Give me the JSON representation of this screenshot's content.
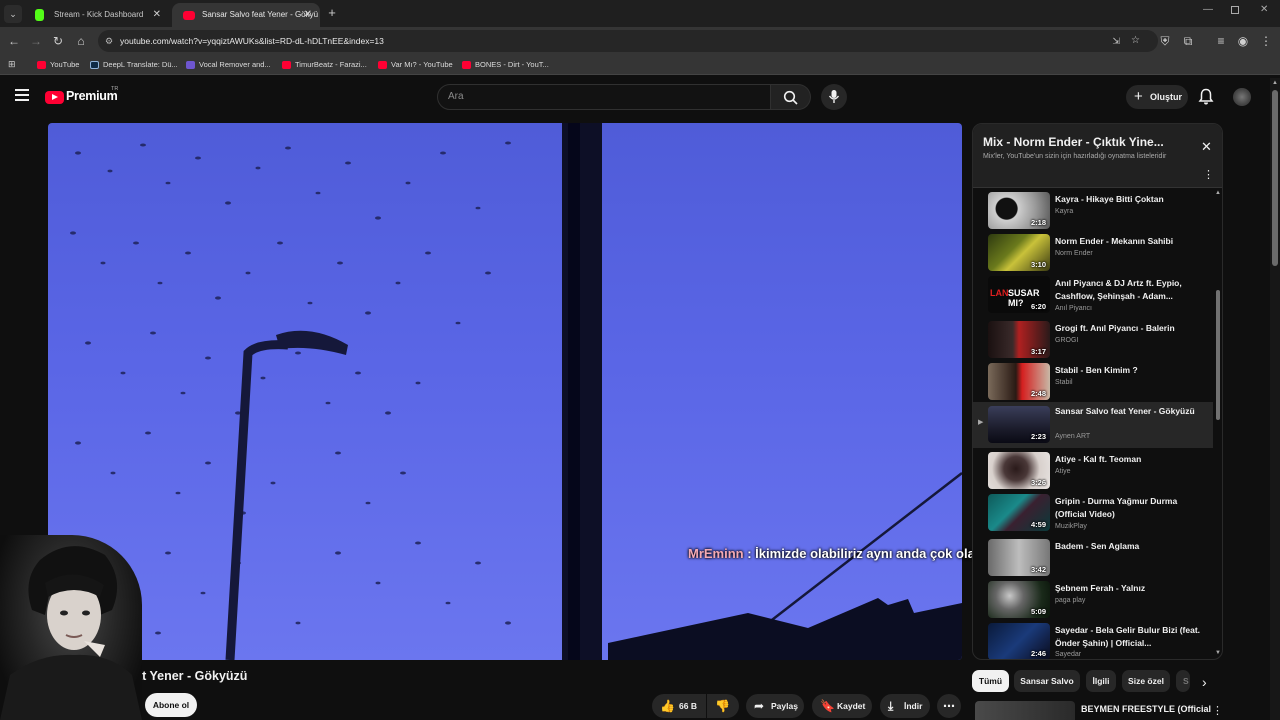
{
  "browser": {
    "tabs": [
      {
        "label": "Stream - Kick Dashboard",
        "close": "✕"
      },
      {
        "label": "Sansar Salvo feat Yener - Gökyü",
        "close": "✕"
      }
    ],
    "new_tab": "+",
    "url": "youtube.com/watch?v=yqqiztAWUKs&list=RD-dL-hDLTnEE&index=13",
    "bookmarks": [
      "YouTube",
      "DeepL Translate: Dü...",
      "Vocal Remover and...",
      "TimurBeatz - Farazi...",
      "Var Mı? - YouTube",
      "BONES - Dirt - YouT..."
    ],
    "colors": {
      "kick": "#53fc18",
      "youtube": "#ff0033",
      "deepl": "#0f2b46",
      "vocal": "#6e56cf"
    }
  },
  "header": {
    "logo_text": "Premium",
    "logo_region": "TR",
    "search_placeholder": "Ara",
    "create_label": "Oluştur"
  },
  "video": {
    "subtitle_user": "MrEminn",
    "subtitle_text": " : İkimizde olabiliriz aynı anda çok olası bu arada",
    "title": "feat Yener - Gökyüzü"
  },
  "actions": {
    "subscribe": "Abone ol",
    "likes": "66 B",
    "share": "Paylaş",
    "save": "Kaydet",
    "download": "İndir"
  },
  "playlist": {
    "title": "Mix - Norm Ender - Çıktık Yine...",
    "subtitle": "Mix'ler, YouTube'un sizin için hazırladığı oynatma listeleridir",
    "items": [
      {
        "title": "Kayra - Hikaye Bitti Çoktan",
        "channel": "Kayra",
        "duration": "2:18"
      },
      {
        "title": "Norm Ender - Mekanın Sahibi",
        "channel": "Norm Ender",
        "duration": "3:10"
      },
      {
        "title": "Anıl Piyancı & DJ Artz ft. Eypio, Cashflow, Şehinşah - Adam...",
        "channel": "Anıl Piyancı",
        "duration": "6:20"
      },
      {
        "title": "Grogi ft. Anıl Piyancı - Balerin",
        "channel": "GROGI",
        "duration": "3:17"
      },
      {
        "title": "Stabil - Ben Kimim ?",
        "channel": "Stabil",
        "duration": "2:48"
      },
      {
        "title": "Sansar Salvo feat Yener - Gökyüzü",
        "channel": "Aynen ART",
        "duration": "2:23",
        "current": true
      },
      {
        "title": "Atiye - Kal ft. Teoman",
        "channel": "Atiye",
        "duration": "3:26"
      },
      {
        "title": "Gripin - Durma Yağmur Durma (Official Video)",
        "channel": "MuzikPlay",
        "duration": "4:59"
      },
      {
        "title": "Badem - Sen Aglama",
        "channel": "",
        "duration": "3:42"
      },
      {
        "title": "Şebnem Ferah - Yalnız",
        "channel": "paga play",
        "duration": "5:09"
      },
      {
        "title": "Sayedar - Bela Gelir Bulur Bizi (feat. Önder Şahin) | Official...",
        "channel": "Sayedar",
        "duration": "2:46"
      }
    ]
  },
  "chips": [
    "Tümü",
    "Sansar Salvo",
    "İlgili",
    "Size özel",
    "S"
  ],
  "next_video": {
    "title": "BEYMEN FREESTYLE (Official"
  }
}
